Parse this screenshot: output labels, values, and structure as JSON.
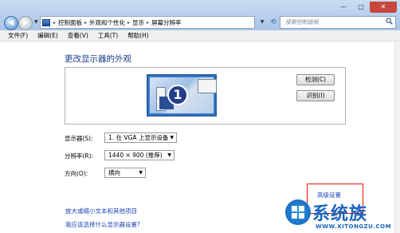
{
  "window": {
    "minimize_label": "—",
    "maximize_label": "□",
    "close_label": "✕"
  },
  "address": {
    "breadcrumb": [
      "控制面板",
      "外观和个性化",
      "显示",
      "屏幕分辨率"
    ],
    "separator": "▸"
  },
  "search": {
    "placeholder": "搜索控制面板"
  },
  "menu": [
    "文件(F)",
    "编辑(E)",
    "查看(V)",
    "工具(T)",
    "帮助(H)"
  ],
  "main": {
    "title": "更改显示器的外观",
    "monitor_number": "1",
    "detect_label": "检测(C)",
    "identify_label": "识别(I)",
    "display_label": "显示器(S):",
    "display_value": "1. 在 VGA 上显示设备",
    "resolution_label": "分辨率(R):",
    "resolution_value": "1440 × 900 (推荐)",
    "orientation_label": "方向(O):",
    "orientation_value": "横向",
    "advanced_link": "高级设置",
    "text_link": "放大或缩小文本和其他项目",
    "help_link": "我应该选择什么显示器设置?"
  },
  "watermark": {
    "brand": "系统族",
    "url": "WWW.XITONGZU.COM"
  },
  "colors": {
    "title_blue": "#1e3d8a",
    "link_blue": "#1a43b3",
    "highlight_red": "#ee1111",
    "brand_blue": "#1764bd"
  }
}
